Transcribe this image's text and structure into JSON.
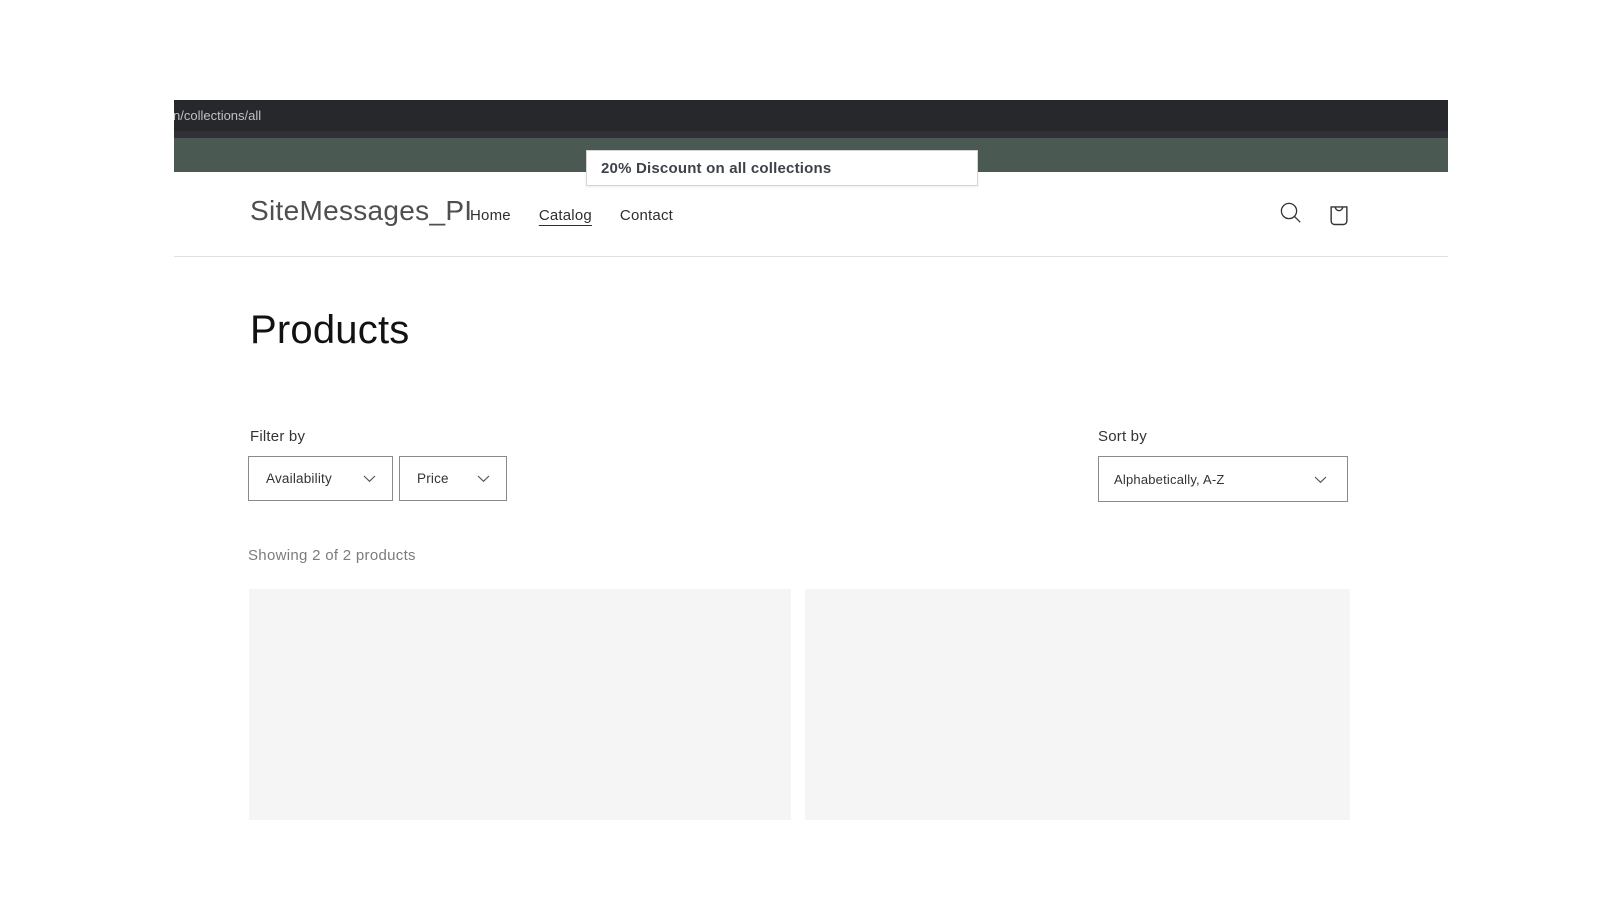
{
  "browser": {
    "address": "n/collections/all"
  },
  "announcement": {
    "tooltip_text": "20% Discount on all collections"
  },
  "header": {
    "logo": "SiteMessages_PI",
    "nav": [
      {
        "label": "Home",
        "active": false
      },
      {
        "label": "Catalog",
        "active": true
      },
      {
        "label": "Contact",
        "active": false
      }
    ],
    "icons": [
      {
        "name": "search-icon"
      },
      {
        "name": "cart-icon"
      }
    ]
  },
  "collection": {
    "title": "Products",
    "filter_label": "Filter by",
    "filters": [
      {
        "label": "Availability"
      },
      {
        "label": "Price"
      }
    ],
    "sort_label": "Sort by",
    "sort_value": "Alphabetically, A-Z",
    "results_summary": "Showing 2 of 2 products",
    "product_count": 2
  },
  "colors": {
    "browser_bar": "#26282c",
    "announcement_bar": "#4a5a53",
    "card_placeholder": "#f5f5f5",
    "tooltip_text": "#3c4248"
  }
}
